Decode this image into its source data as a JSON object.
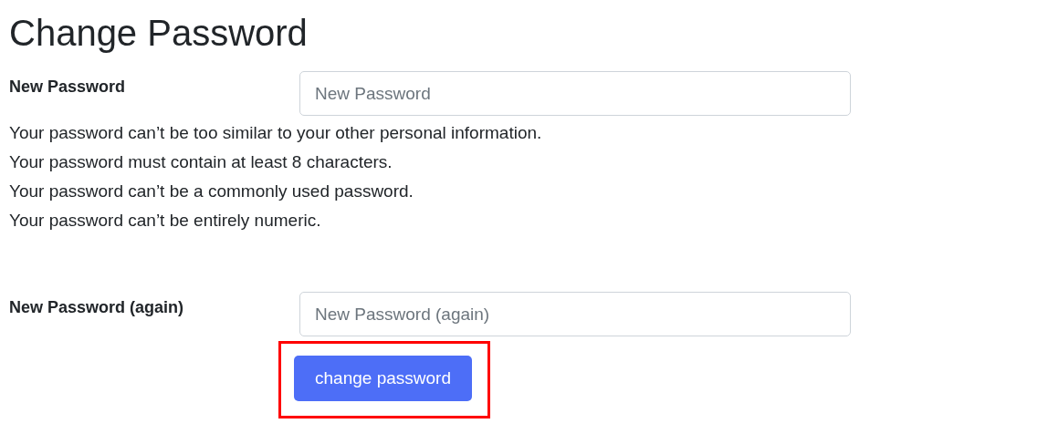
{
  "title": "Change Password",
  "fields": [
    {
      "label": "New Password",
      "placeholder": "New Password",
      "help": [
        "Your password can’t be too similar to your other personal information.",
        "Your password must contain at least 8 characters.",
        "Your password can’t be a commonly used password.",
        "Your password can’t be entirely numeric."
      ]
    },
    {
      "label": "New Password (again)",
      "placeholder": "New Password (again)"
    }
  ],
  "submit": {
    "label": "change password",
    "highlighted": true
  }
}
